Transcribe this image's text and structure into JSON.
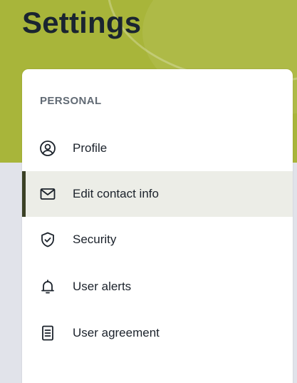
{
  "header": {
    "title": "Settings",
    "accent_color": "#a8b53a"
  },
  "menu": {
    "section_label": "PERSONAL",
    "active_color": "#3b4126",
    "items": [
      {
        "label": "Profile",
        "icon": "user-circle-icon",
        "active": false
      },
      {
        "label": "Edit contact info",
        "icon": "envelope-icon",
        "active": true
      },
      {
        "label": "Security",
        "icon": "shield-check-icon",
        "active": false
      },
      {
        "label": "User alerts",
        "icon": "bell-icon",
        "active": false
      },
      {
        "label": "User agreement",
        "icon": "document-icon",
        "active": false
      }
    ]
  }
}
